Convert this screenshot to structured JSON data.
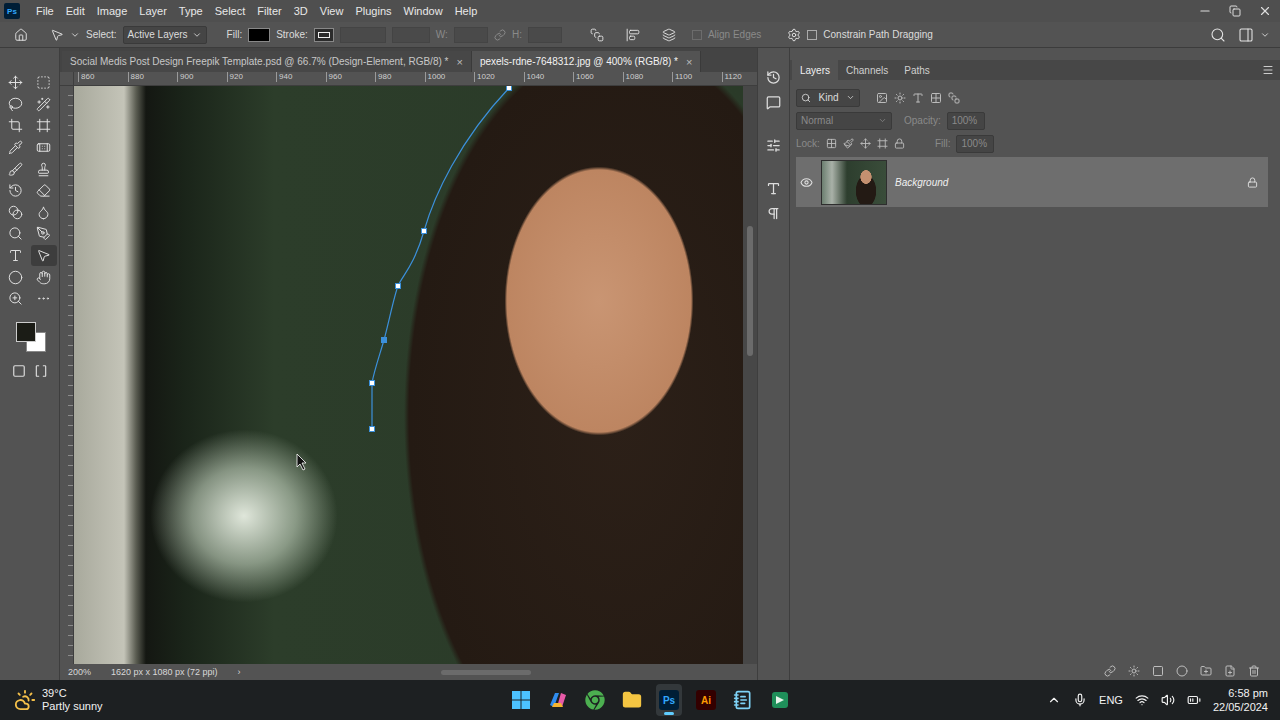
{
  "app": {
    "logo": "Ps"
  },
  "menu": [
    "File",
    "Edit",
    "Image",
    "Layer",
    "Type",
    "Select",
    "Filter",
    "3D",
    "View",
    "Plugins",
    "Window",
    "Help"
  ],
  "options_bar": {
    "select_label": "Select:",
    "select_value": "Active Layers",
    "fill_label": "Fill:",
    "fill_color": "#000000",
    "stroke_label": "Stroke:",
    "w_label": "W:",
    "h_label": "H:",
    "align_edges": {
      "label": "Align Edges",
      "checked": false,
      "disabled": true
    },
    "constrain": {
      "label": "Constrain Path Dragging",
      "checked": false
    }
  },
  "tools": [
    {
      "selected": false
    },
    {
      "selected": false
    },
    {
      "selected": false
    },
    {
      "selected": false
    },
    {
      "selected": false
    },
    {
      "selected": false
    },
    {
      "selected": false
    },
    {
      "selected": false
    },
    {
      "selected": false
    },
    {
      "selected": false
    },
    {
      "selected": false
    },
    {
      "selected": false
    },
    {
      "selected": false
    },
    {
      "selected": false
    },
    {
      "selected": false
    },
    {
      "selected": false
    },
    {
      "selected": false
    },
    {
      "selected": true
    },
    {
      "selected": false
    },
    {
      "selected": false
    },
    {
      "selected": false
    },
    {
      "selected": false
    }
  ],
  "colors": {
    "foreground": "#1b1c16",
    "background": "#ffffff"
  },
  "document_tabs": [
    {
      "title": "Social Medis Post Design Freepik Template.psd @ 66.7% (Design-Element, RGB/8) *",
      "close": "×",
      "selected": false
    },
    {
      "title": "pexels-rdne-7648312.jpg @ 400% (RGB/8) *",
      "close": "×",
      "selected": true
    }
  ],
  "ruler": {
    "ticks": [
      "860",
      "880",
      "900",
      "920",
      "940",
      "960",
      "980",
      "1000",
      "1020",
      "1040",
      "1060",
      "1080",
      "1100",
      "1120"
    ]
  },
  "status_bar": {
    "zoom": "200%",
    "size": "1620 px x 1080 px (72 ppi)",
    "arrow": "›"
  },
  "panel_tabs": [
    {
      "label": "Layers",
      "selected": true
    },
    {
      "label": "Channels",
      "selected": false
    },
    {
      "label": "Paths",
      "selected": false
    }
  ],
  "layers_panel": {
    "filter": "Kind",
    "blend_mode": "Normal",
    "opacity_label": "Opacity:",
    "opacity": "100%",
    "lock_label": "Lock:",
    "fill_label": "Fill:",
    "fill": "100%",
    "controls_disabled": true
  },
  "layers": [
    {
      "name": "Background",
      "visible": true,
      "locked": true,
      "selected": true
    }
  ],
  "taskbar": {
    "temperature": "39°C",
    "weather": "Partly sunny",
    "apps": [
      {
        "kind": "windows",
        "label": "",
        "active": false
      },
      {
        "kind": "copilot",
        "label": "",
        "active": false
      },
      {
        "kind": "chrome",
        "label": "",
        "active": false
      },
      {
        "kind": "explorer",
        "label": "",
        "active": false
      },
      {
        "kind": "photoshop",
        "label": "Ps",
        "active": true
      },
      {
        "kind": "illustrator",
        "label": "Ai",
        "active": false
      },
      {
        "kind": "notepad",
        "label": "",
        "active": false
      },
      {
        "kind": "other",
        "label": "",
        "active": false
      }
    ],
    "language": "ENG",
    "time": "6:58 pm",
    "date": "22/05/2024"
  }
}
